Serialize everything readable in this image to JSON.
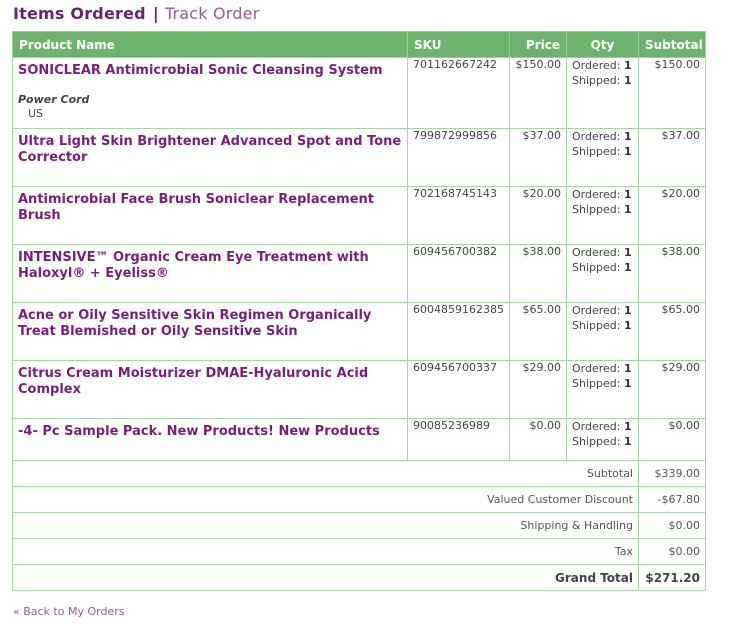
{
  "tabs": {
    "active": "Items Ordered",
    "separator": "|",
    "link": "Track Order"
  },
  "columns": [
    "Product Name",
    "SKU",
    "Price",
    "Qty",
    "Subtotal"
  ],
  "items": [
    {
      "name": "SONICLEAR Antimicrobial Sonic Cleansing System",
      "option_label": "Power Cord",
      "option_value": "US",
      "sku": "701162667242",
      "price": "$150.00",
      "ordered_label": "Ordered:",
      "ordered": "1",
      "shipped_label": "Shipped:",
      "shipped": "1",
      "subtotal": "$150.00"
    },
    {
      "name": "Ultra Light Skin Brightener Advanced Spot and Tone Corrector",
      "sku": "799872999856",
      "price": "$37.00",
      "ordered_label": "Ordered:",
      "ordered": "1",
      "shipped_label": "Shipped:",
      "shipped": "1",
      "subtotal": "$37.00"
    },
    {
      "name": "Antimicrobial Face Brush Soniclear Replacement Brush",
      "sku": "702168745143",
      "price": "$20.00",
      "ordered_label": "Ordered:",
      "ordered": "1",
      "shipped_label": "Shipped:",
      "shipped": "1",
      "subtotal": "$20.00"
    },
    {
      "name": "INTENSIVE™ Organic Cream Eye Treatment with Haloxyl® + Eyeliss®",
      "sku": "609456700382",
      "price": "$38.00",
      "ordered_label": "Ordered:",
      "ordered": "1",
      "shipped_label": "Shipped:",
      "shipped": "1",
      "subtotal": "$38.00"
    },
    {
      "name": "Acne or Oily Sensitive Skin Regimen Organically Treat Blemished or Oily Sensitive Skin",
      "sku": "6004859162385",
      "price": "$65.00",
      "ordered_label": "Ordered:",
      "ordered": "1",
      "shipped_label": "Shipped:",
      "shipped": "1",
      "subtotal": "$65.00"
    },
    {
      "name": "Citrus Cream Moisturizer DMAE-Hyaluronic Acid Complex",
      "sku": "609456700337",
      "price": "$29.00",
      "ordered_label": "Ordered:",
      "ordered": "1",
      "shipped_label": "Shipped:",
      "shipped": "1",
      "subtotal": "$29.00"
    },
    {
      "name": "-4- Pc Sample Pack. New Products! New Products",
      "sku": "90085236989",
      "price": "$0.00",
      "ordered_label": "Ordered:",
      "ordered": "1",
      "shipped_label": "Shipped:",
      "shipped": "1",
      "subtotal": "$0.00"
    }
  ],
  "totals": [
    {
      "label": "Subtotal",
      "value": "$339.00"
    },
    {
      "label": "Valued Customer Discount",
      "value": "-$67.80"
    },
    {
      "label": "Shipping & Handling",
      "value": "$0.00"
    },
    {
      "label": "Tax",
      "value": "$0.00"
    }
  ],
  "grand_total": {
    "label": "Grand Total",
    "value": "$271.20"
  },
  "back_link": "« Back to My Orders",
  "colors": {
    "header_green": "#6db36d",
    "border_green": "#a8d5a8",
    "product_purple": "#7a1f7c",
    "link_purple": "#a0559d"
  }
}
